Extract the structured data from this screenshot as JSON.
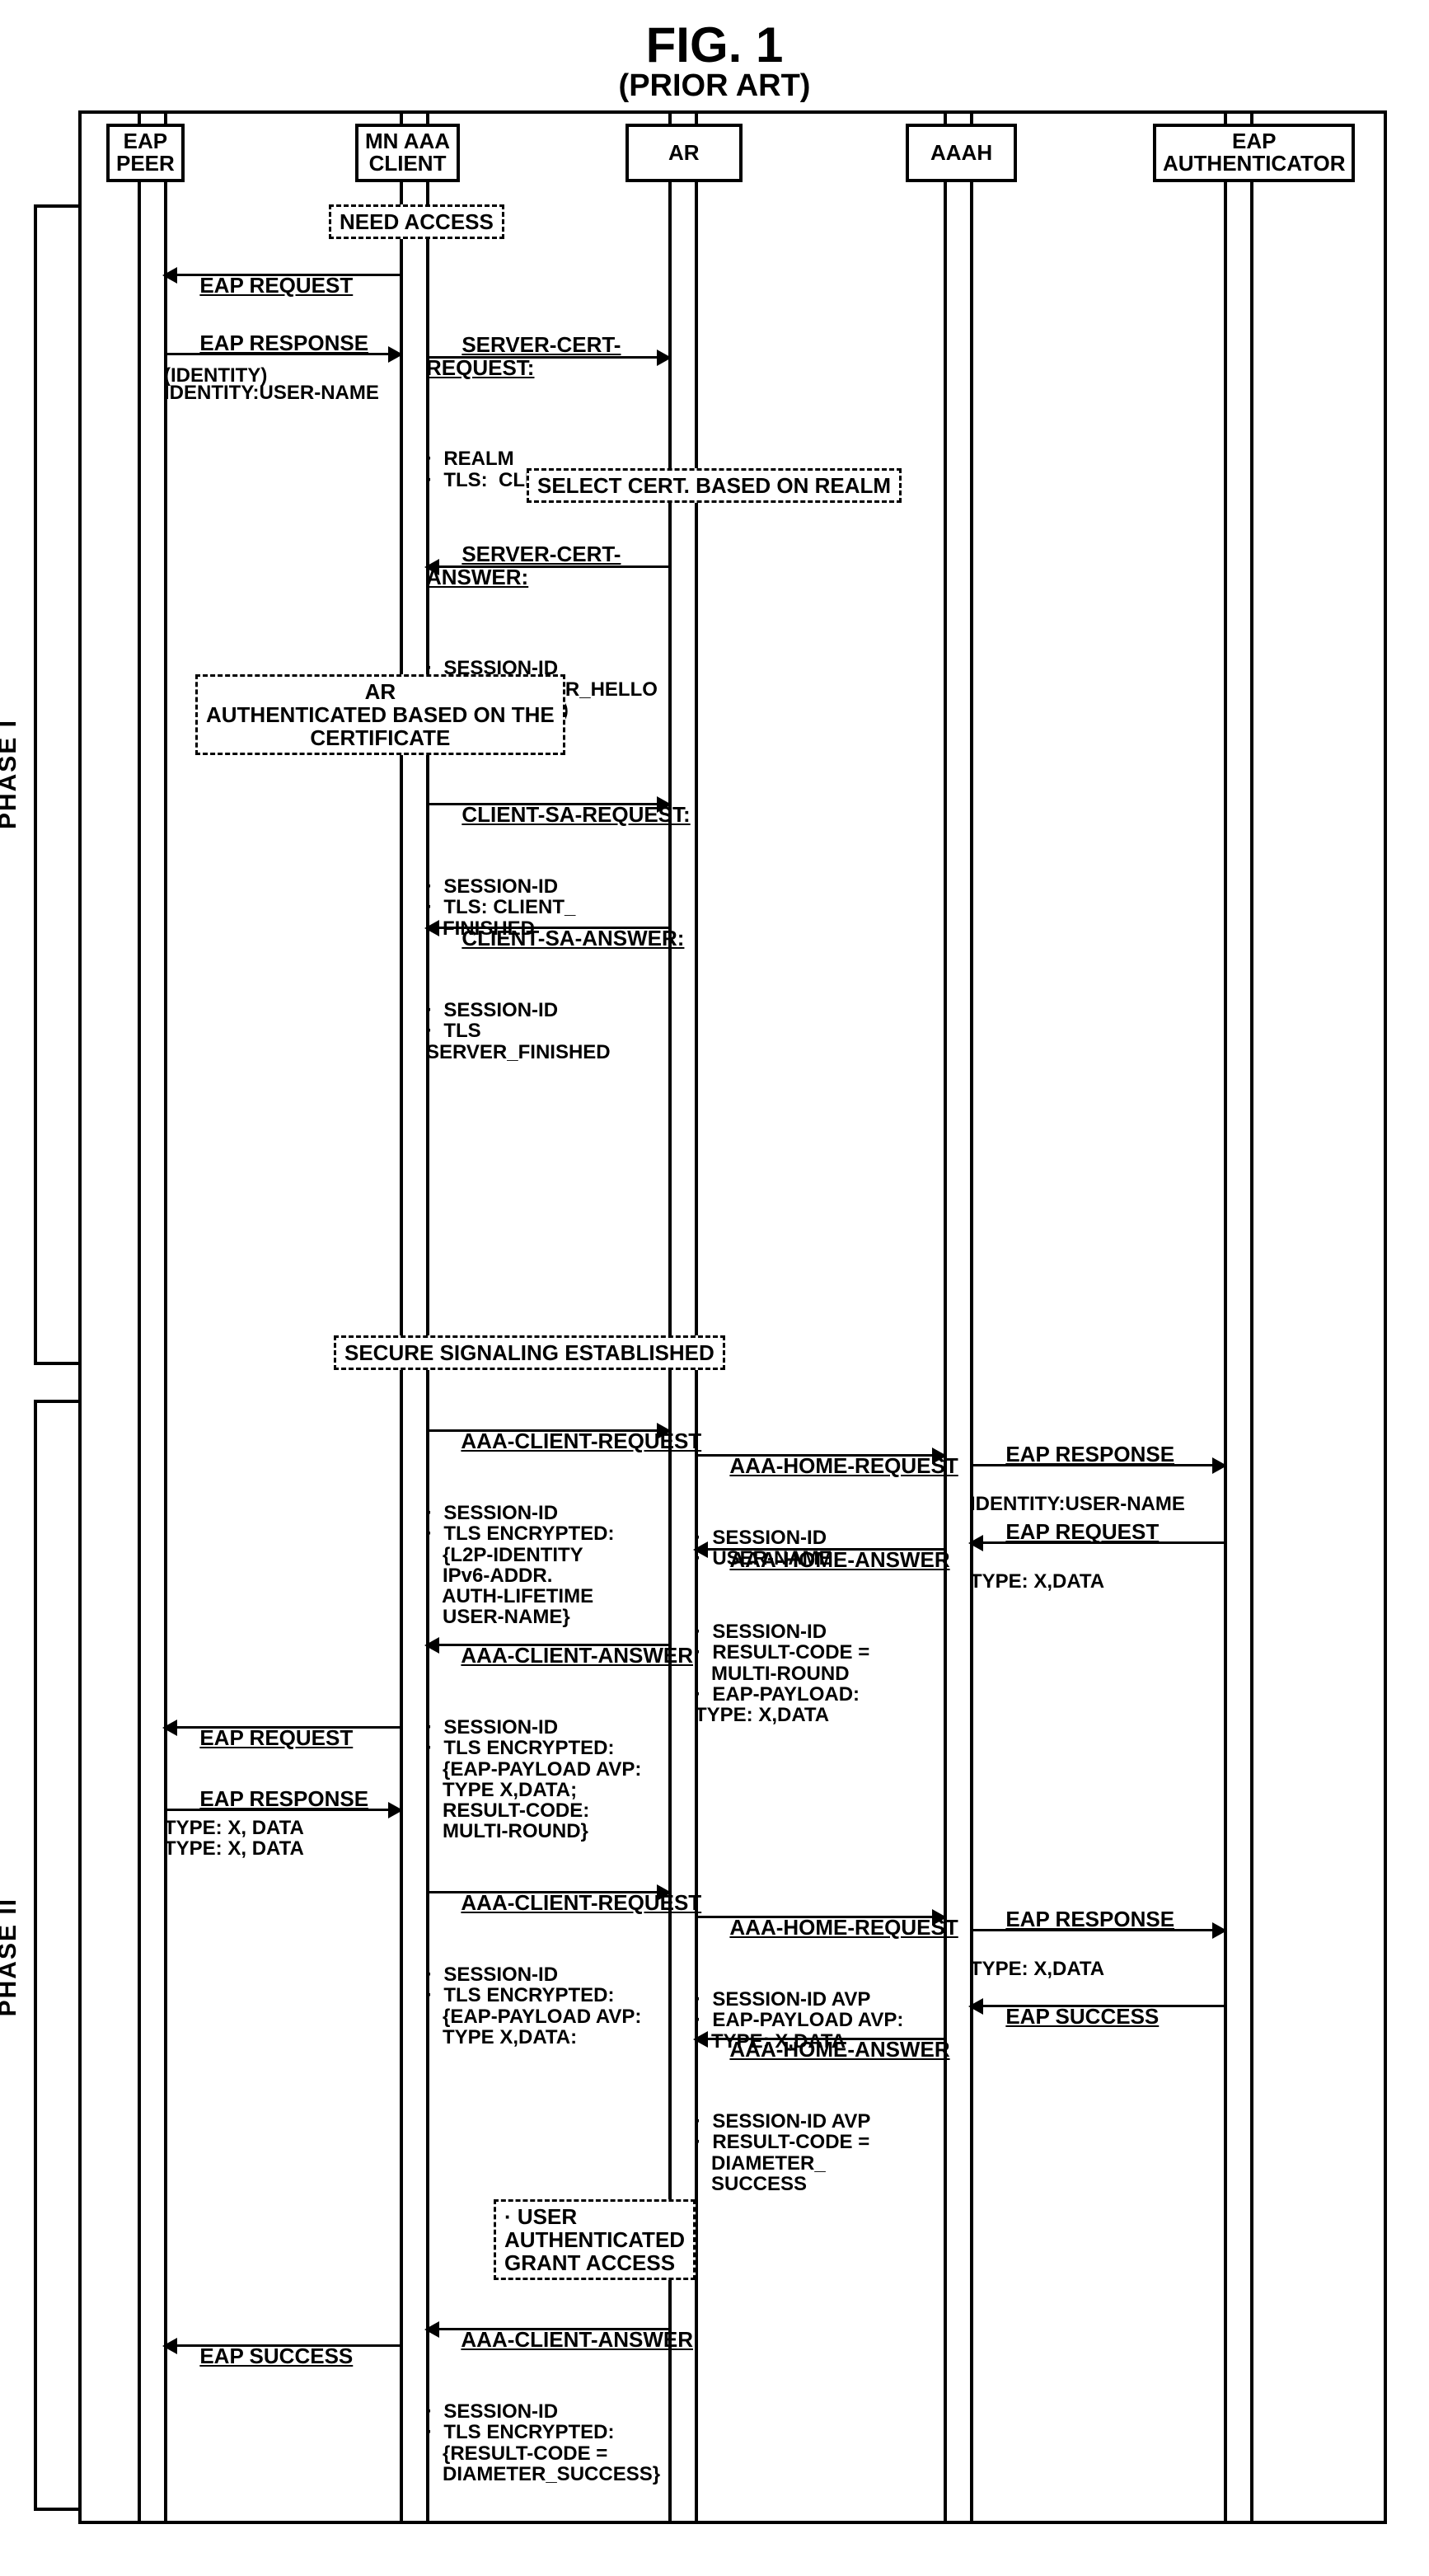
{
  "title": "FIG. 1",
  "subtitle": "(PRIOR  ART)",
  "phases": {
    "p1": "PHASE I",
    "p2": "PHASE II"
  },
  "actors": {
    "eap_peer": "EAP\nPEER",
    "mn_aaa_client": "MN AAA\nCLIENT",
    "ar": "AR",
    "aaah": "AAAH",
    "eap_auth": "EAP\nAUTHENTICATOR"
  },
  "notes": {
    "need_access": "NEED ACCESS",
    "select_cert": "SELECT CERT. BASED ON REALM",
    "ar_auth": "AR\nAUTHENTICATED BASED ON THE\nCERTIFICATE",
    "secure_sig": "SECURE SIGNALING ESTABLISHED",
    "user_auth": "USER\nAUTHENTICATED\nGRANT ACCESS"
  },
  "msgs": {
    "m1": {
      "head": "EAP REQUEST",
      "body": "(IDENTITY)"
    },
    "m2": {
      "head": "EAP RESPONSE",
      "body": "IDENTITY:USER-NAME"
    },
    "m3": {
      "head": "SERVER-CERT-\nREQUEST:",
      "body": "·  REALM\n·  TLS:  CLIENT_HELLO"
    },
    "m4": {
      "head": "SERVER-CERT-\nANSWER:",
      "body": "·  SESSION-ID\n·  TLS:  SERVER_HELLO\n(CERTIFICATE)"
    },
    "m5": {
      "head": "CLIENT-SA-REQUEST:",
      "body": "·  SESSION-ID\n·  TLS: CLIENT_\n   FINISHED"
    },
    "m6": {
      "head": "CLIENT-SA-ANSWER:",
      "body": "·  SESSION-ID\n·  TLS\nSERVER_FINISHED"
    },
    "m7": {
      "head": "AAA-CLIENT-REQUEST",
      "body": "·  SESSION-ID\n·  TLS ENCRYPTED:\n   {L2P-IDENTITY\n   IPv6-ADDR.\n   AUTH-LIFETIME\n   USER-NAME}"
    },
    "m8": {
      "head": "AAA-HOME-REQUEST",
      "body": "·  SESSION-ID\n·  USER-NAME"
    },
    "m9": {
      "head": "EAP RESPONSE",
      "body": "IDENTITY:USER-NAME"
    },
    "m10": {
      "head": "AAA-HOME-ANSWER",
      "body": "·  SESSION-ID\n·  RESULT-CODE =\n   MULTI-ROUND\n·  EAP-PAYLOAD:\nTYPE: X,DATA"
    },
    "m11": {
      "head": "EAP REQUEST",
      "body": "TYPE: X,DATA"
    },
    "m12": {
      "head": "AAA-CLIENT-ANSWER",
      "body": "·  SESSION-ID\n·  TLS ENCRYPTED:\n   {EAP-PAYLOAD AVP:\n   TYPE X,DATA;\n   RESULT-CODE:\n   MULTI-ROUND}"
    },
    "m13": {
      "head": "EAP REQUEST",
      "body": "TYPE: X, DATA"
    },
    "m14": {
      "head": "EAP RESPONSE",
      "body": "TYPE: X, DATA"
    },
    "m15": {
      "head": "AAA-CLIENT-REQUEST",
      "body": "·  SESSION-ID\n·  TLS ENCRYPTED:\n   {EAP-PAYLOAD AVP:\n   TYPE X,DATA:"
    },
    "m16": {
      "head": "AAA-HOME-REQUEST",
      "body": "·  SESSION-ID AVP\n·  EAP-PAYLOAD AVP:\n   TYPE: X,DATA"
    },
    "m17": {
      "head": "EAP RESPONSE",
      "body": "TYPE: X,DATA"
    },
    "m18": {
      "head": "EAP SUCCESS",
      "body": ""
    },
    "m19": {
      "head": "AAA-HOME-ANSWER",
      "body": "·  SESSION-ID AVP\n·  RESULT-CODE =\n   DIAMETER_\n   SUCCESS"
    },
    "m20": {
      "head": "AAA-CLIENT-ANSWER",
      "body": "·  SESSION-ID\n·  TLS ENCRYPTED:\n   {RESULT-CODE =\n   DIAMETER_SUCCESS}"
    },
    "m21": {
      "head": "EAP SUCCESS",
      "body": ""
    }
  }
}
